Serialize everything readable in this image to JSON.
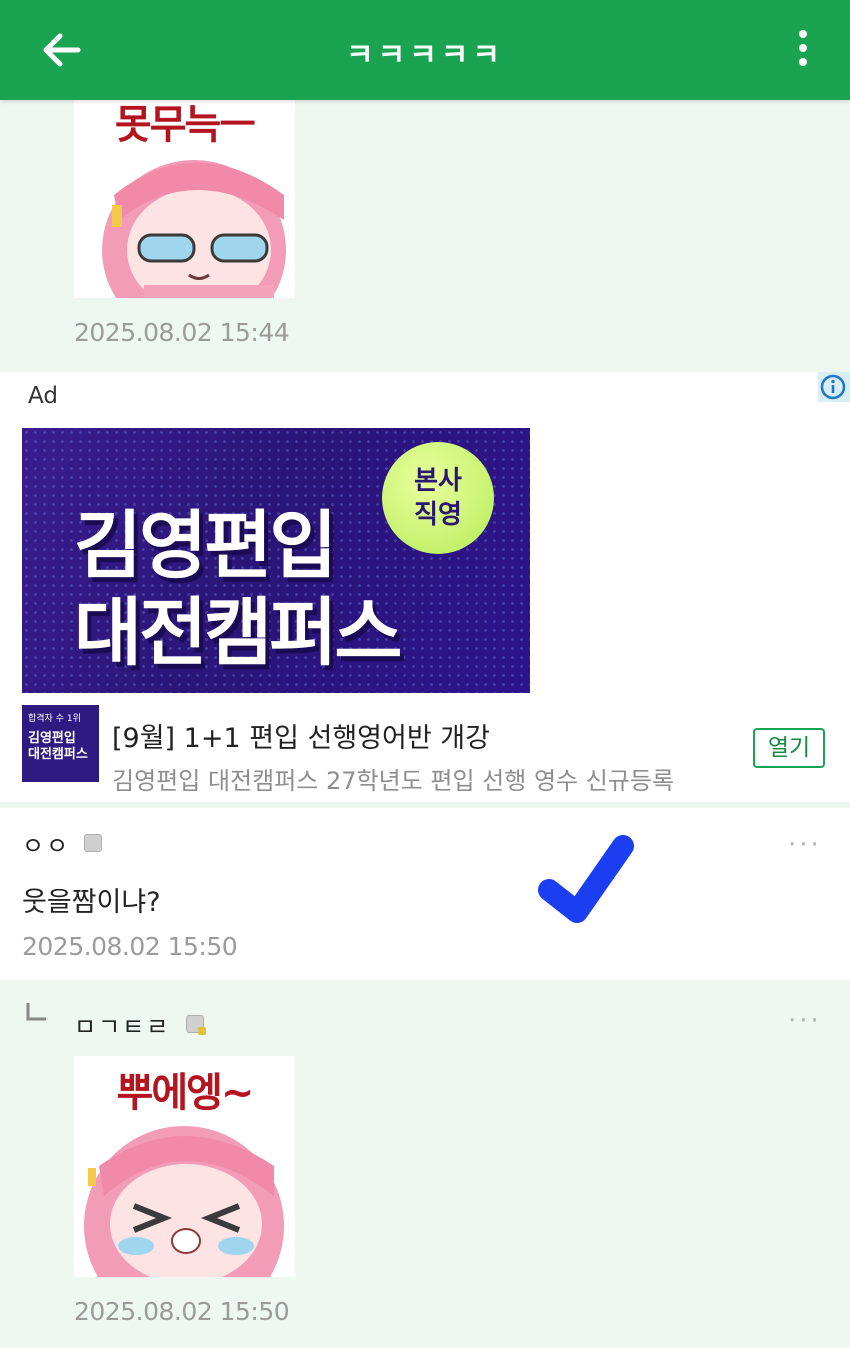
{
  "header": {
    "title": "ㅋㅋㅋㅋㅋ",
    "back_icon": "arrow-left-icon",
    "menu_icon": "more-vertical-icon",
    "bar_color": "#1aa452"
  },
  "comments_top": {
    "sticker_text": "못무늑ㅡ",
    "timestamp": "2025.08.02 15:44"
  },
  "ad": {
    "label": "Ad",
    "banner_line1": "김영편입",
    "banner_line2": "대전캠퍼스",
    "badge_line1": "본사",
    "badge_line2": "직영",
    "thumb_top": "합격자 수 1위",
    "thumb_main_1": "김영편입",
    "thumb_main_2": "대전캠퍼스",
    "headline": "[9월] 1+1 편입 선행영어반 개강",
    "description": "김영편입 대전캠퍼스 27학년도 편입 선행 영수 신규등록",
    "open_label": "열기"
  },
  "comment": {
    "nickname": "ㅇㅇ",
    "text": "웃을짬이냐?",
    "timestamp": "2025.08.02 15:50",
    "more": "···"
  },
  "reply": {
    "nickname": "ㅁㄱㅌㄹ",
    "sticker_text": "뿌에엥~",
    "timestamp": "2025.08.02 15:50",
    "more": "···"
  }
}
